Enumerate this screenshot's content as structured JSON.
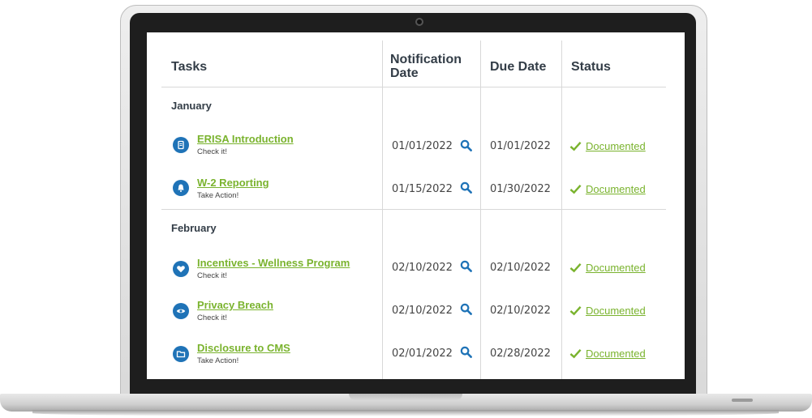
{
  "table": {
    "headers": {
      "tasks": "Tasks",
      "notification_line1": "Notification",
      "notification_line2": "Date",
      "due_date": "Due Date",
      "status": "Status"
    },
    "months": [
      {
        "name": "January",
        "tasks": [
          {
            "title": "ERISA Introduction",
            "subtitle": "Check it!",
            "icon": "document-icon",
            "notification_date": "01/01/2022",
            "due_date": "01/01/2022",
            "status": "Documented"
          },
          {
            "title": "W-2 Reporting",
            "subtitle": "Take Action!",
            "icon": "bell-icon",
            "notification_date": "01/15/2022",
            "due_date": "01/30/2022",
            "status": "Documented"
          }
        ]
      },
      {
        "name": "February",
        "tasks": [
          {
            "title": "Incentives - Wellness Program",
            "subtitle": "Check it!",
            "icon": "heart-icon",
            "notification_date": "02/10/2022",
            "due_date": "02/10/2022",
            "status": "Documented"
          },
          {
            "title": "Privacy Breach",
            "subtitle": "Check it!",
            "icon": "eye-icon",
            "notification_date": "02/10/2022",
            "due_date": "02/10/2022",
            "status": "Documented"
          },
          {
            "title": "Disclosure to CMS",
            "subtitle": "Take Action!",
            "icon": "folder-icon",
            "notification_date": "02/01/2022",
            "due_date": "02/28/2022",
            "status": "Documented"
          }
        ]
      }
    ]
  },
  "colors": {
    "link_green": "#7ab32e",
    "icon_blue": "#1f73b7",
    "header_text": "#333d47"
  }
}
